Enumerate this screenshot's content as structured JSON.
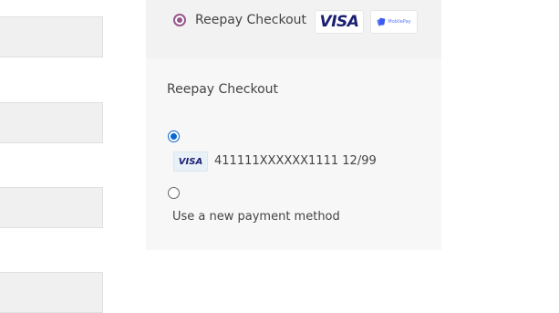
{
  "payment_method": {
    "label": "Reepay Checkout",
    "selected": true,
    "logos": [
      {
        "name": "visa",
        "text": "VISA"
      },
      {
        "name": "mobilepay",
        "text": "MobilePay"
      }
    ]
  },
  "section": {
    "title": "Reepay Checkout"
  },
  "saved_card": {
    "selected": true,
    "brand": "VISA",
    "number_expiry": "411111XXXXXX1111 12/99"
  },
  "new_method": {
    "label": "Use a new payment method",
    "selected": false
  },
  "colors": {
    "accent": "#96588a",
    "radio_selected": "#0a66d0",
    "visa_blue": "#1a1f71",
    "mobilepay_blue": "#5a78ff"
  },
  "icons": [
    "visa-logo-icon",
    "mobilepay-logo-icon",
    "visa-card-icon"
  ]
}
